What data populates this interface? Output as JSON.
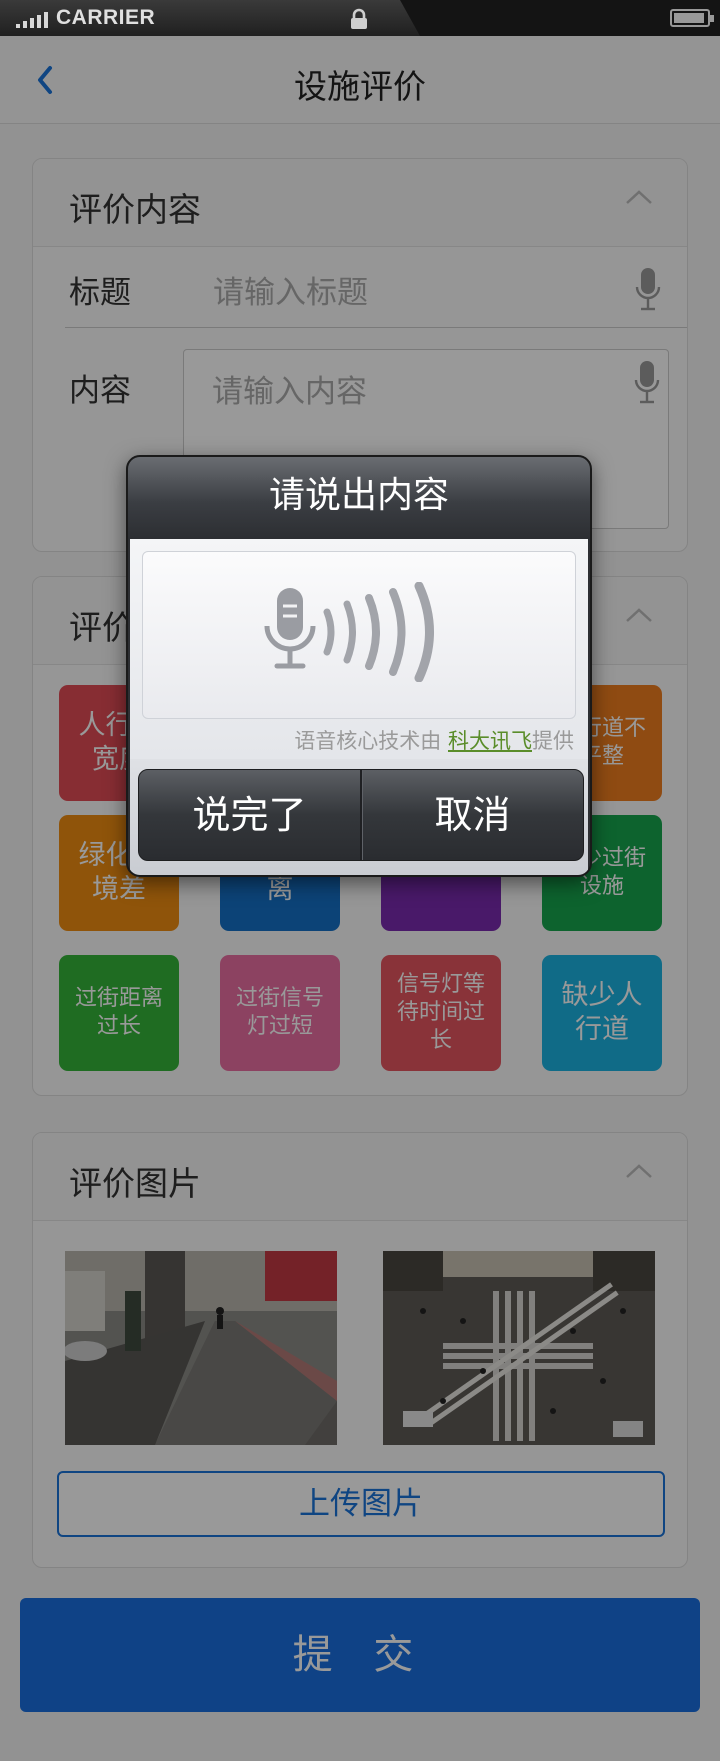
{
  "status_bar": {
    "carrier": "CARRIER"
  },
  "nav": {
    "title": "设施评价"
  },
  "content_card": {
    "title": "评价内容",
    "title_label": "标题",
    "title_placeholder": "请输入标题",
    "content_label": "内容",
    "content_placeholder": "请输入内容"
  },
  "type_card": {
    "title": "评价",
    "tiles": [
      {
        "label": "人行道宽度",
        "color": "#e24c55"
      },
      {
        "label": "",
        "color": "#1c6fc2"
      },
      {
        "label": "",
        "color": "#7b2dbd"
      },
      {
        "label": "人行道不平整",
        "color": "#ef7d1f"
      },
      {
        "label": "绿化环境差",
        "color": "#ef8d12"
      },
      {
        "label": "道未隔离",
        "color": "#1570c7"
      },
      {
        "label": "",
        "color": "#7a2aaf"
      },
      {
        "label": "缺少过街设施",
        "color": "#17a54d"
      },
      {
        "label": "过街距离过长",
        "color": "#34b539"
      },
      {
        "label": "过街信号灯过短",
        "color": "#ea6fa2"
      },
      {
        "label": "信号灯等待时间过长",
        "color": "#e5555f"
      },
      {
        "label": "缺少人行道",
        "color": "#1cb2e1"
      }
    ]
  },
  "photo_card": {
    "title": "评价图片",
    "upload_label": "上传图片"
  },
  "submit_label": "提 交",
  "dialog": {
    "title": "请说出内容",
    "credit_prefix": "语音核心技术由 ",
    "credit_link": "科大讯飞",
    "credit_suffix": "提供",
    "done_label": "说完了",
    "cancel_label": "取消"
  },
  "colors": {
    "accent": "#1a6fe0"
  }
}
